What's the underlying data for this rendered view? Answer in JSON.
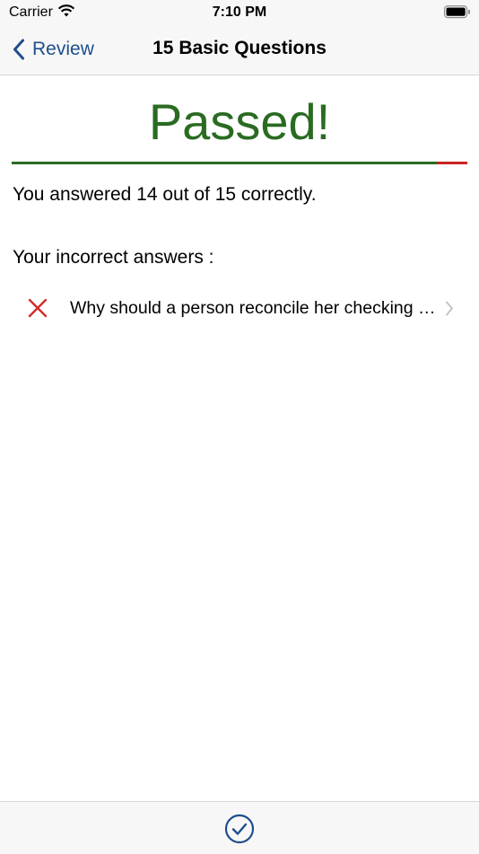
{
  "status_bar": {
    "carrier": "Carrier",
    "time": "7:10 PM"
  },
  "nav": {
    "back_label": "Review",
    "title": "15 Basic Questions"
  },
  "result": {
    "title": "Passed!",
    "correct": 14,
    "total": 15,
    "score_fraction": 0.9333,
    "summary": "You answered 14 out of 15 correctly."
  },
  "incorrect": {
    "heading": "Your incorrect answers :",
    "items": [
      {
        "text": "Why should a person reconcile her checking account?"
      }
    ]
  },
  "colors": {
    "pass_green": "#2a6b22",
    "fail_red": "#cc2222",
    "accent_blue": "#1f4e8c"
  },
  "icons": {
    "status": [
      "wifi-icon",
      "battery-icon"
    ],
    "nav": "chevron-left-icon",
    "row": [
      "x-mark-icon",
      "chevron-right-icon"
    ],
    "toolbar": "checkmark-circle-icon"
  }
}
